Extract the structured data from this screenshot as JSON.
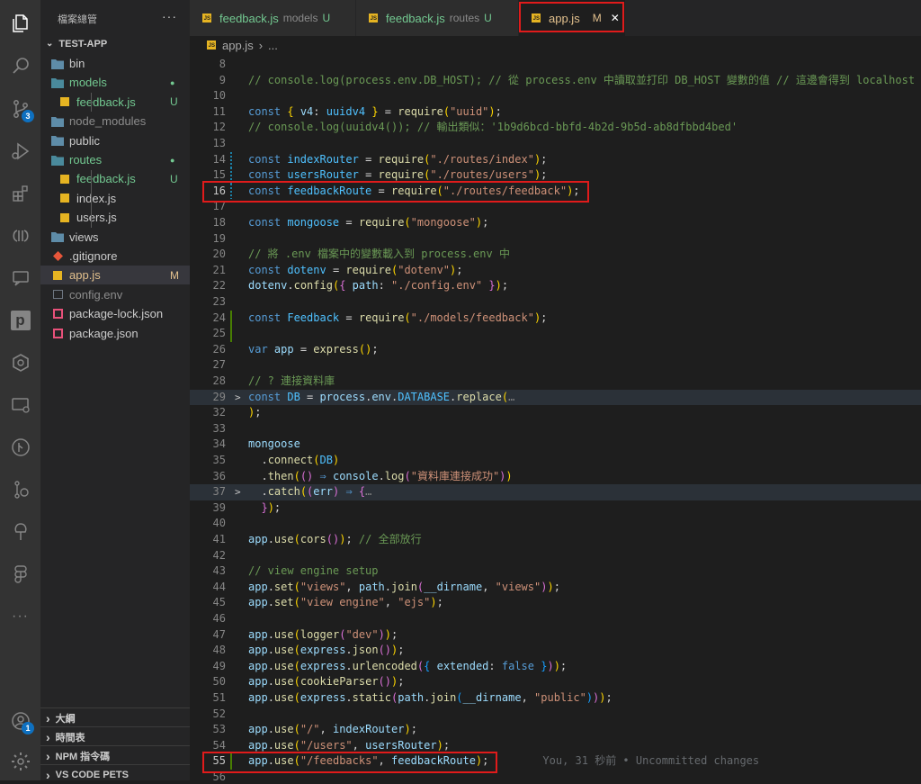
{
  "sidebar": {
    "title": "檔案總管",
    "more": "···",
    "root": "TEST-APP",
    "tree": [
      {
        "label": "bin",
        "kind": "folder",
        "status": ""
      },
      {
        "label": "models",
        "kind": "folder-open",
        "status": "●"
      },
      {
        "label": "feedback.js",
        "kind": "js",
        "status": "U"
      },
      {
        "label": "node_modules",
        "kind": "folder",
        "status": ""
      },
      {
        "label": "public",
        "kind": "folder",
        "status": ""
      },
      {
        "label": "routes",
        "kind": "folder-open",
        "status": "●"
      },
      {
        "label": "feedback.js",
        "kind": "js",
        "status": "U"
      },
      {
        "label": "index.js",
        "kind": "js",
        "status": ""
      },
      {
        "label": "users.js",
        "kind": "js",
        "status": ""
      },
      {
        "label": "views",
        "kind": "folder",
        "status": ""
      },
      {
        "label": ".gitignore",
        "kind": "git",
        "status": ""
      },
      {
        "label": "app.js",
        "kind": "js",
        "status": "M"
      },
      {
        "label": "config.env",
        "kind": "env",
        "status": ""
      },
      {
        "label": "package-lock.json",
        "kind": "json",
        "status": ""
      },
      {
        "label": "package.json",
        "kind": "json",
        "status": ""
      }
    ],
    "panels": [
      "大綱",
      "時間表",
      "NPM 指令碼",
      "VS CODE PETS"
    ]
  },
  "activity": {
    "source_control_badge": "3",
    "accounts_badge": "1",
    "more": "···",
    "p_letter": "p"
  },
  "tabs": [
    {
      "name": "feedback.js",
      "desc": "models",
      "status": "U"
    },
    {
      "name": "feedback.js",
      "desc": "routes",
      "status": "U"
    },
    {
      "name": "app.js",
      "desc": "",
      "status": "M"
    }
  ],
  "tab_close": "✕",
  "breadcrumb": {
    "file": "app.js",
    "sep": "›",
    "more": "..."
  },
  "blame": "You, 31 秒前 • Uncommitted changes",
  "colors": {
    "accent": "#0e70c0",
    "highlight_box": "#e01b1b",
    "modified": "#e2c08d",
    "untracked": "#73c991"
  }
}
